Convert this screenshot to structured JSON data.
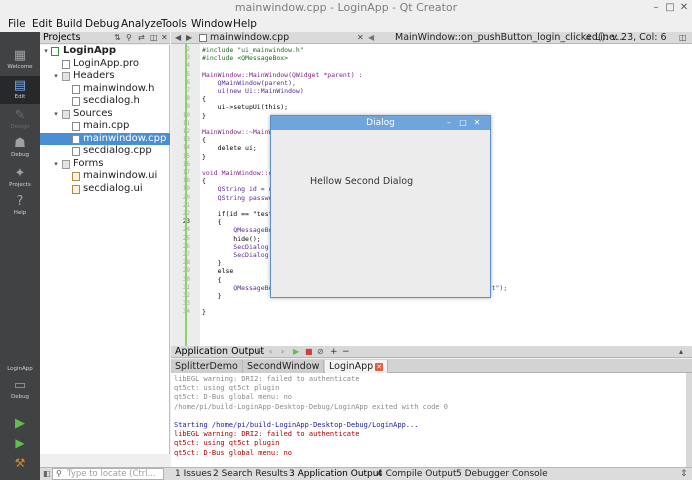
{
  "window": {
    "title": "mainwindow.cpp - LoginApp - Qt Creator"
  },
  "menubar": [
    "File",
    "Edit",
    "Build",
    "Debug",
    "Analyze",
    "Tools",
    "Window",
    "Help"
  ],
  "modes": [
    {
      "label": "Welcome",
      "icon": "grid-icon"
    },
    {
      "label": "Edit",
      "icon": "document-icon",
      "active": true
    },
    {
      "label": "Design",
      "icon": "pencil-icon",
      "disabled": true
    },
    {
      "label": "Debug",
      "icon": "bug-icon"
    },
    {
      "label": "Projects",
      "icon": "wrench-icon"
    },
    {
      "label": "Help",
      "icon": "help-icon"
    }
  ],
  "kit": {
    "project": "LoginApp",
    "config": "Debug"
  },
  "projects": {
    "header_label": "Projects",
    "tree": [
      {
        "label": "LoginApp",
        "bold": true
      },
      {
        "label": "LoginApp.pro"
      },
      {
        "label": "Headers"
      },
      {
        "label": "mainwindow.h"
      },
      {
        "label": "secdialog.h"
      },
      {
        "label": "Sources"
      },
      {
        "label": "main.cpp"
      },
      {
        "label": "mainwindow.cpp",
        "selected": true
      },
      {
        "label": "secdialog.cpp"
      },
      {
        "label": "Forms"
      },
      {
        "label": "mainwindow.ui"
      },
      {
        "label": "secdialog.ui"
      }
    ]
  },
  "editor": {
    "file_tab": "mainwindow.cpp",
    "function_combo": "MainWindow::on_pushButton_login_clicked(): v...",
    "cursor": "Line: 23, Col: 6",
    "line_numbers": [
      "2",
      "3",
      "4",
      "5",
      "6",
      "7",
      "8",
      "9",
      "10",
      "11",
      "12",
      "13",
      "14",
      "15",
      "16",
      "17",
      "18",
      "19",
      "20",
      "21",
      "22",
      "23",
      "24",
      "25",
      "26",
      "27",
      "28",
      "29",
      "30",
      "31",
      "32",
      "33",
      "34"
    ],
    "lines": [
      "#include \"ui_mainwindow.h\"",
      "#include <QMessageBox>",
      "",
      "MainWindow::MainWindow(QWidget *parent) :",
      "    QMainWindow(parent),",
      "    ui(new Ui::MainWindow)",
      "{",
      "    ui->setupUi(this);",
      "}",
      "",
      "MainWindow::~MainWindow()",
      "{",
      "    delete ui;",
      "}",
      "",
      "void MainWindow::on_pushButton_login_clicked()",
      "{",
      "    QString id = ui->lineEdit_id->text();",
      "    QString password = ui->lineEdit_password->text();",
      "",
      "    if(id == \"test\" && password == \"test\") {",
      "    {",
      "        QMessageBox::information(this, \"Login\", \"Correct\");",
      "        hide();",
      "        SecDialog secDialog;",
      "        SecDialog.setModal(true);",
      "    }",
      "    else",
      "    {",
      "        QMessageBox::warning(this, \"Login\", \"ID and password is not correct\");",
      "    }",
      "",
      "}"
    ]
  },
  "dialog": {
    "title": "Dialog",
    "label": "Hellow Second Dialog"
  },
  "output": {
    "header": "Application Output",
    "tabs": [
      {
        "label": "SplitterDemo"
      },
      {
        "label": "SecondWindow"
      },
      {
        "label": "LoginApp",
        "active": true
      }
    ],
    "lines": [
      {
        "text": "libEGL warning: DRI2: failed to authenticate",
        "color": "#8a8a8a"
      },
      {
        "text": "qt5ct: using qt5ct plugin",
        "color": "#8a8a8a"
      },
      {
        "text": "qt5ct: D-Bus global menu: no",
        "color": "#8a8a8a"
      },
      {
        "text": "/home/pi/build-LoginApp-Desktop-Debug/LoginApp exited with code 0",
        "color": "#8a8a8a"
      },
      {
        "text": "",
        "color": "#000000"
      },
      {
        "text": "Starting /home/pi/build-LoginApp-Desktop-Debug/LoginApp...",
        "color": "#1a1aa8"
      },
      {
        "text": "libEGL warning: DRI2: failed to authenticate",
        "color": "#b00000"
      },
      {
        "text": "qt5ct: using qt5ct plugin",
        "color": "#b00000"
      },
      {
        "text": "qt5ct: D-Bus global menu: no",
        "color": "#b00000"
      }
    ]
  },
  "statusbar": {
    "locator_placeholder": "Type to locate (Ctrl...",
    "panes": [
      "1 Issues",
      "2 Search Results",
      "3 Application Output",
      "4 Compile Output",
      "5 Debugger Console"
    ]
  },
  "colors": {
    "accent": "#4a8ed4",
    "dialog_title": "#6fa4dc"
  }
}
